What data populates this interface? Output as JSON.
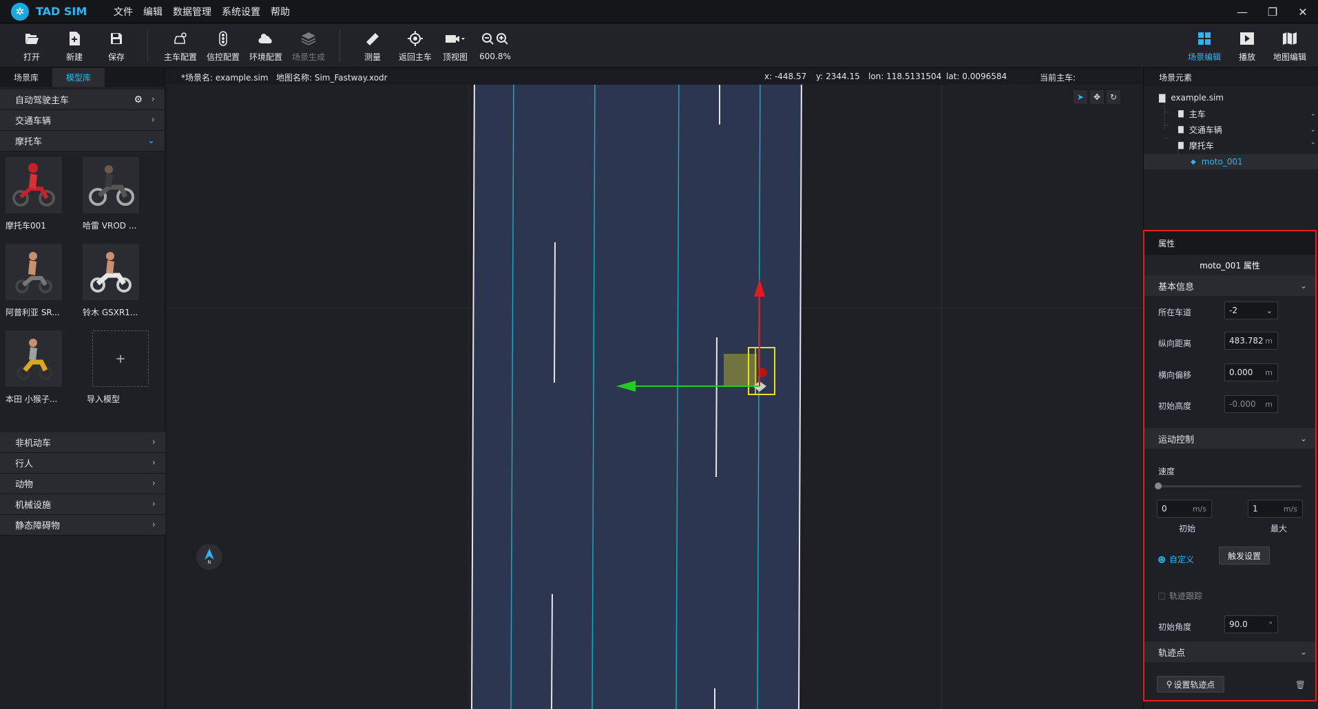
{
  "app": {
    "title": "TAD SIM"
  },
  "menu": [
    "文件",
    "编辑",
    "数据管理",
    "系统设置",
    "帮助"
  ],
  "toolbar": {
    "open": "打开",
    "new": "新建",
    "save": "保存",
    "ego_config": "主车配置",
    "signal_config": "信控配置",
    "env_config": "环境配置",
    "scene_gen": "场景生成",
    "measure": "测量",
    "return_ego": "返回主车",
    "top_view": "顶视图",
    "zoom": "600.8%",
    "scene_edit": "场景编辑",
    "play": "播放",
    "map_edit": "地图编辑"
  },
  "left": {
    "tabs": [
      "场景库",
      "模型库"
    ],
    "categories_top": [
      "自动驾驶主车",
      "交通车辆",
      "摩托车"
    ],
    "models": [
      "摩托车001",
      "哈雷 VROD ...",
      "阿普利亚 SR...",
      "铃木 GSXR1...",
      "本田 小猴子...",
      "导入模型"
    ],
    "import_symbol": "+",
    "categories_bottom": [
      "非机动车",
      "行人",
      "动物",
      "机械设施",
      "静态障碍物"
    ]
  },
  "viewport": {
    "scene_name": "*场景名: example.sim",
    "map_name": "地图名称: Sim_Fastway.xodr",
    "x": "x: -448.57",
    "y": "y: 2344.15",
    "lon": "lon: 118.5131504",
    "lat": "lat: 0.0096584",
    "current_ego": "当前主车:",
    "compass": "N"
  },
  "scene_tree": {
    "title": "场景元素",
    "root": "example.sim",
    "nodes": [
      "主车",
      "交通车辆",
      "摩托车"
    ],
    "selected": "moto_001"
  },
  "props": {
    "header": "属性",
    "name": "moto_001 属性",
    "basic_section": "基本信息",
    "lane_label": "所在车道",
    "lane_value": "-2",
    "long_label": "纵向距离",
    "long_value": "483.782",
    "long_unit": "m",
    "lat_label": "横向偏移",
    "lat_value": "0.000",
    "lat_unit": "m",
    "height_label": "初始高度",
    "height_value": "-0.000",
    "height_unit": "m",
    "motion_section": "运动控制",
    "speed_label": "速度",
    "speed_init": "0",
    "speed_max": "1",
    "speed_unit": "m/s",
    "init_label": "初始",
    "max_label": "最大",
    "custom_label": "自定义",
    "trigger_btn": "触发设置",
    "track_label": "轨迹跟踪",
    "angle_label": "初始角度",
    "angle_value": "90.0",
    "angle_unit": "°",
    "waypoint_section": "轨迹点",
    "set_waypoint_btn": "设置轨迹点"
  }
}
